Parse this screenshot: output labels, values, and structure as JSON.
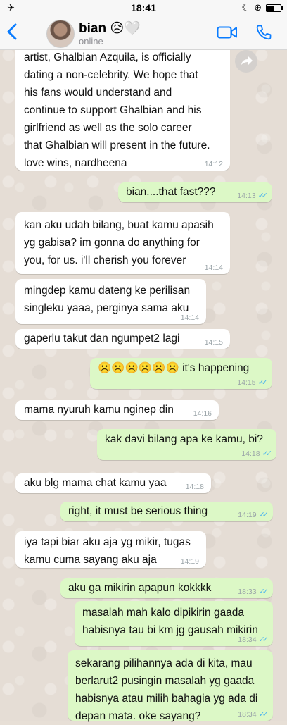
{
  "status_bar": {
    "time": "18:41",
    "airplane_icon": "airplane-icon",
    "battery_level": 0.55
  },
  "header": {
    "back_icon": "chevron-left-icon",
    "contact_name": "bian 😥🤍",
    "contact_status": "online",
    "video_icon": "video-icon",
    "call_icon": "phone-icon"
  },
  "messages": [
    {
      "dir": "in",
      "text": "artist, Ghalbian Azquila, is officially\ndating a non-celebrity. We hope that\nhis fans would understand and\ncontinue to support Ghalbian and his\ngirlfriend as well as the solo career\nthat Ghalbian will present in the future.\nlove wins, nardheena",
      "time": "14:12"
    },
    {
      "dir": "out",
      "text": "bian....that fast???",
      "time": "14:13"
    },
    {
      "dir": "in",
      "text": "kan aku udah bilang, buat kamu apasih\nyg gabisa? im gonna do anything for\nyou, for us. i'll cherish you forever",
      "time": "14:14"
    },
    {
      "dir": "in",
      "text": "mingdep kamu dateng ke perilisan\nsingleku yaaa, perginya sama aku",
      "time": "14:14"
    },
    {
      "dir": "in",
      "text": "gaperlu takut dan ngumpet2 lagi",
      "time": "14:15"
    },
    {
      "dir": "out",
      "text": "☹️☹️☹️☹️☹️☹️ it's happening",
      "time": "14:15"
    },
    {
      "dir": "in",
      "text": "mama nyuruh kamu nginep din",
      "time": "14:16"
    },
    {
      "dir": "out",
      "text": "kak davi bilang apa ke kamu, bi?",
      "time": "14:18"
    },
    {
      "dir": "in",
      "text": "aku blg mama chat kamu yaa",
      "time": "14:18"
    },
    {
      "dir": "out",
      "text": "right, it must be serious thing",
      "time": "14:19"
    },
    {
      "dir": "in",
      "text": "iya tapi biar aku aja yg mikir, tugas\nkamu cuma sayang aku aja",
      "time": "14:19"
    },
    {
      "dir": "out",
      "text": "aku ga mikirin apapun kokkkk",
      "time": "18:33"
    },
    {
      "dir": "out",
      "text": "masalah mah kalo dipikirin gaada\nhabisnya tau bi km jg gausah mikirin",
      "time": "18:34"
    },
    {
      "dir": "out",
      "text": "sekarang pilihannya ada di kita, mau\nberlarut2 pusingin masalah yg gaada\nhabisnya atau milih bahagia yg ada di\ndepan mata. oke sayang?",
      "time": "18:34"
    }
  ],
  "read_ticks": "✓✓",
  "forward_icon": "forward-arrow-icon"
}
